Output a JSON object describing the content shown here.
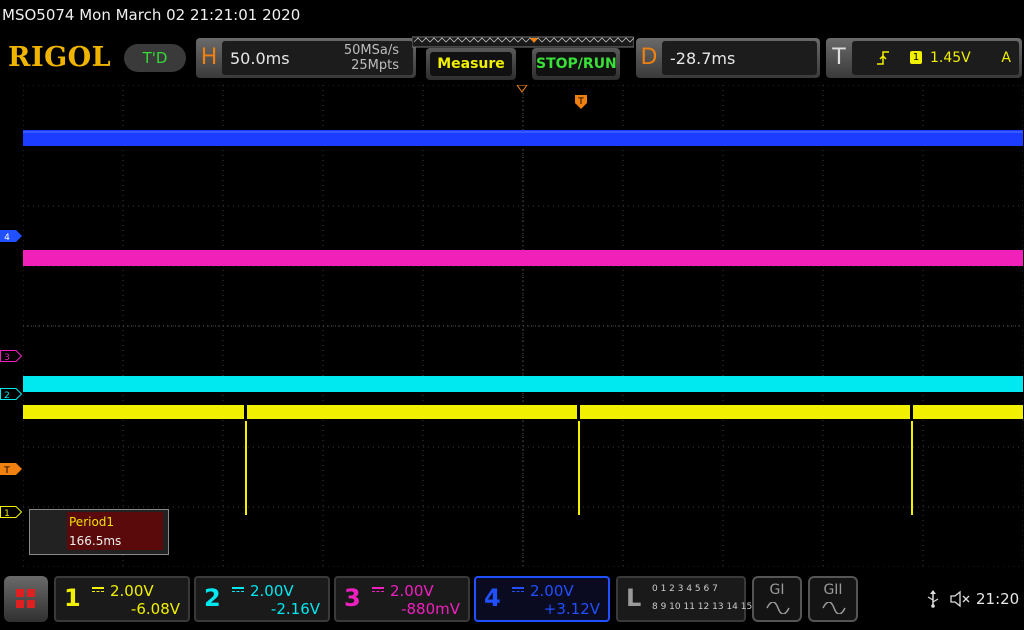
{
  "title_bar": {
    "text": "MSO5074  Mon March 02 21:21:01 2020"
  },
  "top": {
    "brand": "RIGOL",
    "mode_badge": "T'D",
    "horizontal": {
      "key": "H",
      "timebase": "50.0ms",
      "sample_rate": "50MSa/s",
      "memory_depth": "25Mpts"
    },
    "measure_label": "Measure",
    "stop_run_label": "STOP/RUN",
    "delay": {
      "key": "D",
      "value": "-28.7ms"
    },
    "trigger": {
      "key": "T",
      "source": "1",
      "level": "1.45V",
      "mode": "A"
    }
  },
  "screen": {
    "channel_markers": [
      "4",
      "3",
      "2",
      "T",
      "1"
    ],
    "trigger_marker": "T",
    "measurement": {
      "label": "Period1",
      "value": "166.5ms"
    }
  },
  "channels": [
    {
      "num": "1",
      "scale": "2.00V",
      "offset": "-6.08V",
      "color": "#f0f000"
    },
    {
      "num": "2",
      "scale": "2.00V",
      "offset": "-2.16V",
      "color": "#00e8f0"
    },
    {
      "num": "3",
      "scale": "2.00V",
      "offset": "-880mV",
      "color": "#f020c0"
    },
    {
      "num": "4",
      "scale": "2.00V",
      "offset": "+3.12V",
      "color": "#2050ff"
    }
  ],
  "logic": {
    "key": "L",
    "row1": "0 1 2 3  4 5 6 7",
    "row2": "8 9 10 11 12 13 14 15"
  },
  "generators": [
    "GI",
    "GII"
  ],
  "status": {
    "clock": "21:20"
  },
  "colors": {
    "brand": "#f0b400",
    "accent": "#f08010",
    "measure_bg": "#5a0a0a"
  }
}
